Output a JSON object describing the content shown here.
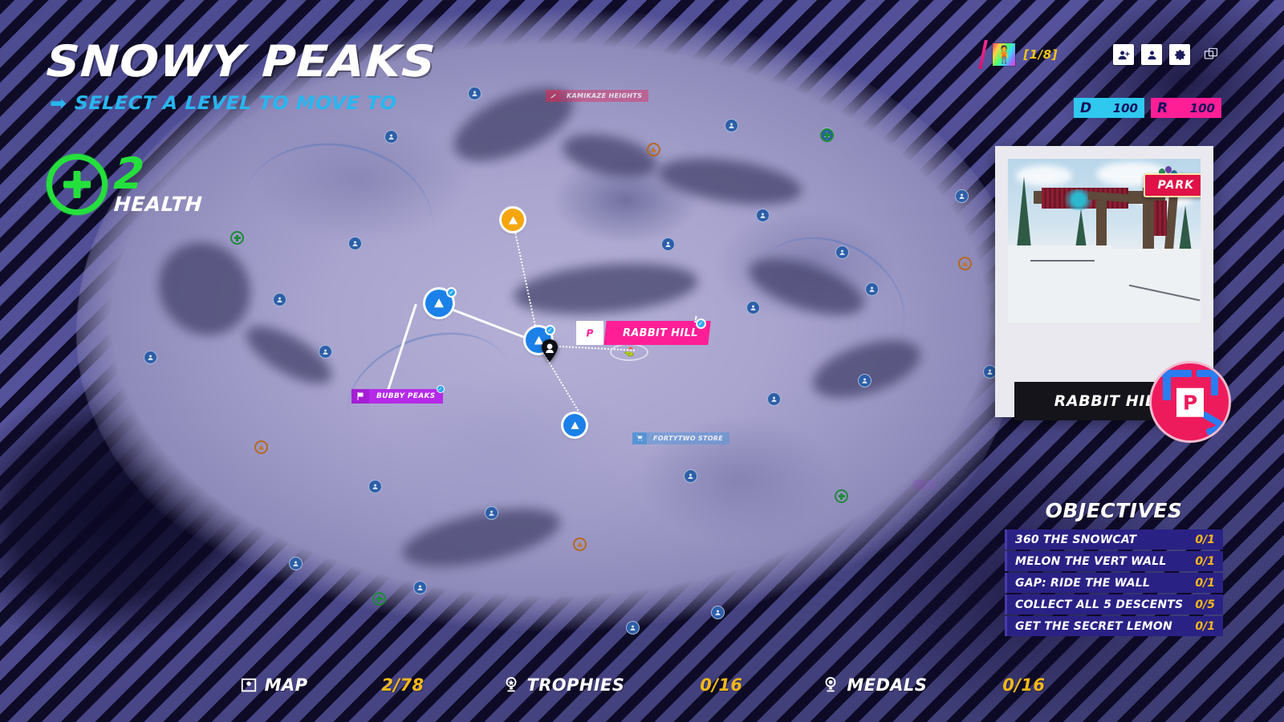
{
  "header": {
    "title": "SNOWY PEAKS",
    "subtitle": "SELECT A LEVEL TO MOVE TO",
    "arrow_icon": "arrow-right-icon"
  },
  "health": {
    "value": "2",
    "label": "HEALTH",
    "icon": "plus-circle-icon",
    "color": "#25e03c"
  },
  "hud": {
    "avatar": {
      "icon": "character-avatar-icon",
      "count": "[1/8]"
    },
    "buttons": [
      {
        "name": "add-friend-button",
        "icon": "person-add-icon"
      },
      {
        "name": "profile-button",
        "icon": "person-icon"
      },
      {
        "name": "settings-button",
        "icon": "gear-icon"
      }
    ],
    "window_button": {
      "name": "window-toggle-button",
      "icon": "windows-copy-icon"
    },
    "currencies": [
      {
        "name": "cash",
        "glyph": "D",
        "value": "100",
        "color": "#2fc8ef"
      },
      {
        "name": "rep",
        "glyph": "R",
        "value": "100",
        "color": "#ff1e96"
      }
    ]
  },
  "level_card": {
    "badge": "PARK",
    "caption": "RABBIT HILL",
    "stamp_letter": "P",
    "photo_alt": "ski-lift-photo"
  },
  "objectives": {
    "title": "OBJECTIVES",
    "items": [
      {
        "label": "360 THE SNOWCAT",
        "count": "0/1"
      },
      {
        "label": "MELON THE VERT WALL",
        "count": "0/1"
      },
      {
        "label": "GAP: RIDE THE WALL",
        "count": "0/1"
      },
      {
        "label": "COLLECT ALL 5 DESCENTS",
        "count": "0/5"
      },
      {
        "label": "GET THE SECRET LEMON",
        "count": "0/1"
      }
    ]
  },
  "bottom_bar": {
    "stats": [
      {
        "label": "MAP",
        "value": "2/78",
        "icon": "map-pin-icon"
      },
      {
        "label": "TROPHIES",
        "value": "0/16",
        "icon": "trophy-icon"
      },
      {
        "label": "MEDALS",
        "value": "0/16",
        "icon": "medal-icon"
      }
    ]
  },
  "map": {
    "labels": {
      "rabbit_hill": "RABBIT HILL",
      "bubby_peaks": "BUBBY PEAKS",
      "kamikaze_heights": "KAMIKAZE HEIGHTS",
      "fortytwo_store": "FORTYTWO STORE",
      "faint_label": ""
    },
    "nodes": [
      {
        "name": "level-node-west",
        "type": "peak",
        "completed": true
      },
      {
        "name": "level-node-center",
        "type": "peak",
        "completed": true
      },
      {
        "name": "level-node-south",
        "type": "peak",
        "completed": false
      },
      {
        "name": "level-node-north",
        "type": "warning",
        "completed": false
      }
    ],
    "player_marker": "player-position-pin"
  }
}
